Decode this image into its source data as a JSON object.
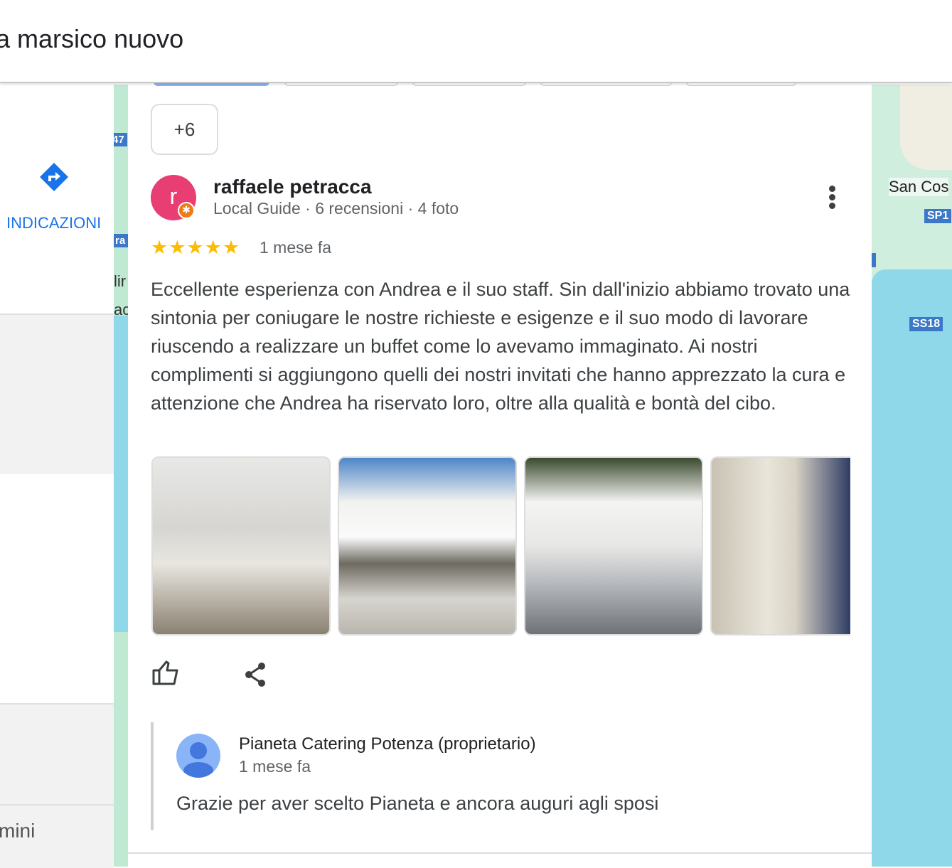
{
  "search": {
    "query": "nza marsico nuovo"
  },
  "left_panel": {
    "directions_label": "INDICAZIONI",
    "bottom_text": "mini"
  },
  "map": {
    "labels": {
      "place": "San Cos",
      "road1": "SP1",
      "road2": "SS18",
      "road3": "47",
      "road4": "ra",
      "text1": "lir",
      "text2": "ac"
    }
  },
  "review": {
    "more_photos": "+6",
    "avatar_letter": "r",
    "author": "raffaele petracca",
    "meta": "Local Guide · 6 recensioni · 4 foto",
    "rating": 5,
    "stars": "★★★★★",
    "date": "1 mese fa",
    "text": "Eccellente esperienza con Andrea e il suo staff. Sin dall'inizio abbiamo trovato una sintonia per coniugare le nostre richieste e esigenze e il suo modo di lavorare riuscendo a realizzare un buffet come lo avevamo immaginato. Ai nostri complimenti si aggiungono quelli dei nostri invitati che hanno apprezzato la cura e attenzione che Andrea ha riservato loro, oltre alla qualità e bontà del cibo.",
    "photo_count_shown": 4
  },
  "owner_reply": {
    "name": "Pianeta Catering Potenza (proprietario)",
    "date": "1 mese fa",
    "text": "Grazie per aver scelto Pianeta e ancora auguri agli sposi"
  },
  "colors": {
    "accent": "#1a73e8",
    "avatar": "#e83e74",
    "star": "#fbbc04"
  }
}
